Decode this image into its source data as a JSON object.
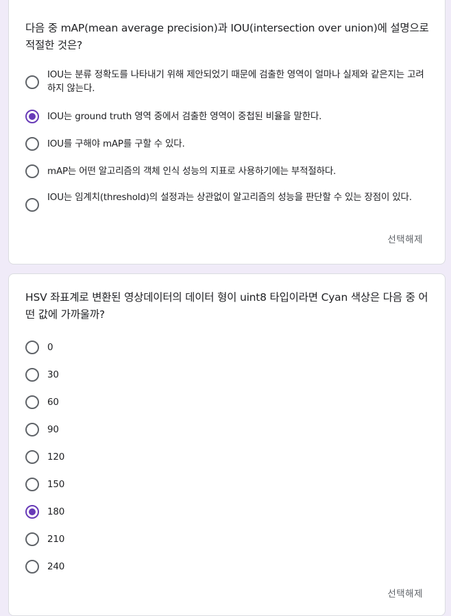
{
  "questions": [
    {
      "title": "다음 중 mAP(mean average precision)과 IOU(intersection over union)에 설명으로 적절한 것은?",
      "options": [
        "IOU는 분류 정확도를 나타내기 위해 제안되었기 때문에 검출한 영역이 얼마나 실제와 같은지는 고려하지 않는다.",
        "IOU는 ground truth 영역 중에서 검출한 영역이 중첩된 비율을 말한다.",
        "IOU를 구해야 mAP를 구할 수 있다.",
        "mAP는 어떤 알고리즘의 객체 인식 성능의 지표로 사용하기에는 부적절하다.",
        "IOU는 임계치(threshold)의 설정과는 상관없이 알고리즘의 성능을 판단할 수 있는 장점이 있다."
      ],
      "selected_index": 1,
      "clear_label": "선택해제"
    },
    {
      "title": "HSV 좌표계로 변환된 영상데이터의 데이터 형이 uint8 타입이라면 Cyan 색상은 다음 중 어떤 값에 가까울까?",
      "options": [
        "0",
        "30",
        "60",
        "90",
        "120",
        "150",
        "180",
        "210",
        "240"
      ],
      "selected_index": 6,
      "clear_label": "선택해제"
    }
  ],
  "colors": {
    "background": "#f0ebf8",
    "accent": "#673ab7",
    "radio_border": "#5f6368"
  }
}
